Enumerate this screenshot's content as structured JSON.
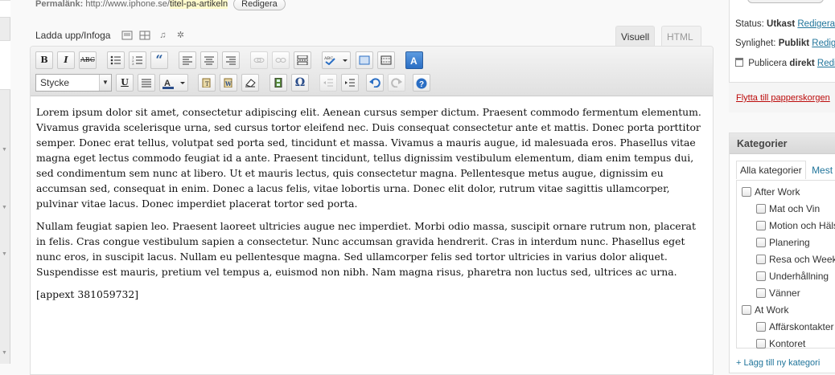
{
  "permalink": {
    "label": "Permalänk:",
    "url_base": "http://www.iphone.se/",
    "slug": "titel-pa-artikeln",
    "edit_button": "Redigera"
  },
  "upload": {
    "label": "Ladda upp/Infoga"
  },
  "editor_tabs": {
    "visual": "Visuell",
    "html": "HTML"
  },
  "toolbar": {
    "styles_select": "Stycke",
    "bold": "B",
    "italic": "I",
    "strike": "ABC",
    "underline": "U",
    "special_char": "Ω"
  },
  "content": {
    "paragraphs": [
      "Lorem ipsum dolor sit amet, consectetur adipiscing elit. Aenean cursus semper dictum. Praesent commodo fermentum elementum. Vivamus gravida scelerisque urna, sed cursus tortor eleifend nec. Duis consequat consectetur ante et mattis. Donec porta porttitor semper. Donec erat tellus, volutpat sed porta sed, tincidunt et massa. Vivamus a mauris augue, id malesuada eros. Phasellus vitae magna eget lectus commodo feugiat id a ante. Praesent tincidunt, tellus dignissim vestibulum elementum, diam enim tempus dui, sed condimentum sem nunc at libero. Ut et mauris lectus, quis consectetur magna. Pellentesque metus augue, dignissim eu accumsan sed, consequat in enim. Donec a lacus felis, vitae lobortis urna. Donec elit dolor, rutrum vitae sagittis ullamcorper, pulvinar vitae lacus. Donec imperdiet placerat tortor sed porta.",
      "Nullam feugiat sapien leo. Praesent laoreet ultricies augue nec imperdiet. Morbi odio massa, suscipit ornare rutrum non, placerat in felis. Cras congue vestibulum sapien a consectetur. Nunc accumsan gravida hendrerit. Cras in interdum nunc. Phasellus eget nunc eros, in suscipit lacus. Nullam eu pellentesque magna. Sed ullamcorper felis sed tortor ultricies in varius dolor aliquet. Suspendisse est mauris, pretium vel tempus a, euismod non nibh. Nam magna risus, pharetra non luctus sed, ultrices ac urna.",
      "[appext 381059732]"
    ]
  },
  "publish": {
    "status_label": "Status:",
    "status_value": "Utkast",
    "status_edit": "Redigera",
    "visibility_label": "Synlighet:",
    "visibility_value": "Publikt",
    "visibility_edit": "Redigera",
    "publish_label": "Publicera",
    "publish_value": "direkt",
    "publish_edit": "Redigera",
    "trash_link": "Flytta till papperskorgen"
  },
  "categories": {
    "title": "Kategorier",
    "tab_all": "Alla kategorier",
    "tab_most": "Mest använda",
    "items": [
      {
        "label": "After Work",
        "level": 0
      },
      {
        "label": "Mat och Vin",
        "level": 1
      },
      {
        "label": "Motion och Hälsa",
        "level": 1
      },
      {
        "label": "Planering",
        "level": 1
      },
      {
        "label": "Resa och Weekend",
        "level": 1
      },
      {
        "label": "Underhållning",
        "level": 1
      },
      {
        "label": "Vänner",
        "level": 1
      },
      {
        "label": "At Work",
        "level": 0
      },
      {
        "label": "Affärskontakter",
        "level": 1
      },
      {
        "label": "Kontoret",
        "level": 1
      }
    ],
    "add_new": "+ Lägg till ny kategori"
  },
  "colors": {
    "link": "#21759b",
    "trash": "#bc0b0b",
    "slug_bg": "#fffbcc"
  }
}
